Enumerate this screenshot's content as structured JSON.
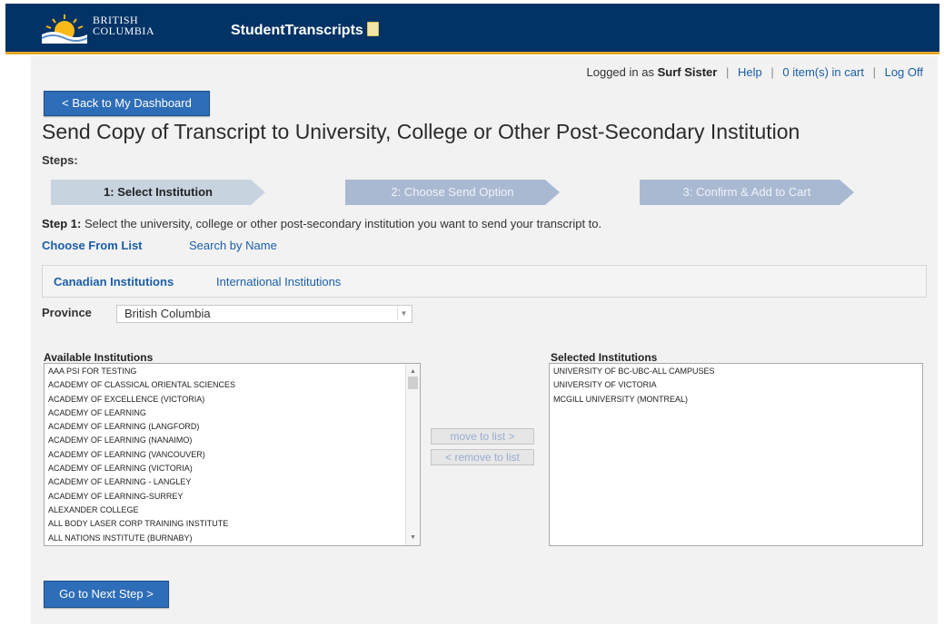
{
  "header": {
    "logo_line1": "BRITISH",
    "logo_line2": "COLUMBIA",
    "app_title": "StudentTranscripts"
  },
  "topbar": {
    "logged_in_prefix": "Logged in as",
    "username": "Surf Sister",
    "help": "Help",
    "cart": "0 item(s) in cart",
    "logoff": "Log Off"
  },
  "back_button": "< Back to My Dashboard",
  "page_title": "Send Copy of Transcript to University, College or Other Post-Secondary Institution",
  "steps_label": "Steps:",
  "steps": [
    {
      "label": "1: Select Institution",
      "state": "active"
    },
    {
      "label": "2: Choose Send Option",
      "state": "inactive"
    },
    {
      "label": "3: Confirm & Add to Cart",
      "state": "inactive"
    }
  ],
  "step_description": {
    "bold": "Step 1:",
    "text": "Select the university, college or other post-secondary institution you want to send your transcript to."
  },
  "choose_links": {
    "list": "Choose From List",
    "search": "Search by Name"
  },
  "institution_tabs": {
    "canadian": "Canadian Institutions",
    "international": "International Institutions"
  },
  "province": {
    "label": "Province",
    "selected": "British Columbia"
  },
  "available": {
    "title": "Available Institutions",
    "items": [
      "AAA PSI FOR TESTING",
      "ACADEMY OF CLASSICAL ORIENTAL SCIENCES",
      "ACADEMY OF EXCELLENCE (VICTORIA)",
      "ACADEMY OF LEARNING",
      "ACADEMY OF LEARNING (LANGFORD)",
      "ACADEMY OF LEARNING (NANAIMO)",
      "ACADEMY OF LEARNING (VANCOUVER)",
      "ACADEMY OF LEARNING (VICTORIA)",
      "ACADEMY OF LEARNING - LANGLEY",
      "ACADEMY OF LEARNING-SURREY",
      "ALEXANDER COLLEGE",
      "ALL BODY LASER CORP TRAINING INSTITUTE",
      "ALL NATIONS INSTITUTE (BURNABY)"
    ]
  },
  "selected": {
    "title": "Selected Institutions",
    "items": [
      "UNIVERSITY OF BC-UBC-ALL CAMPUSES",
      "UNIVERSITY OF VICTORIA",
      "MCGILL UNIVERSITY (MONTREAL)"
    ]
  },
  "move_button": "move to list >",
  "remove_button": "< remove to list",
  "next_button": "Go to Next Step >",
  "colors": {
    "header_bg": "#013366",
    "header_accent": "#e3a82b",
    "link": "#1b5ea9",
    "button_blue": "#2e6db8",
    "step_active": "#c8d3e0",
    "step_inactive": "#a9b9d2"
  }
}
